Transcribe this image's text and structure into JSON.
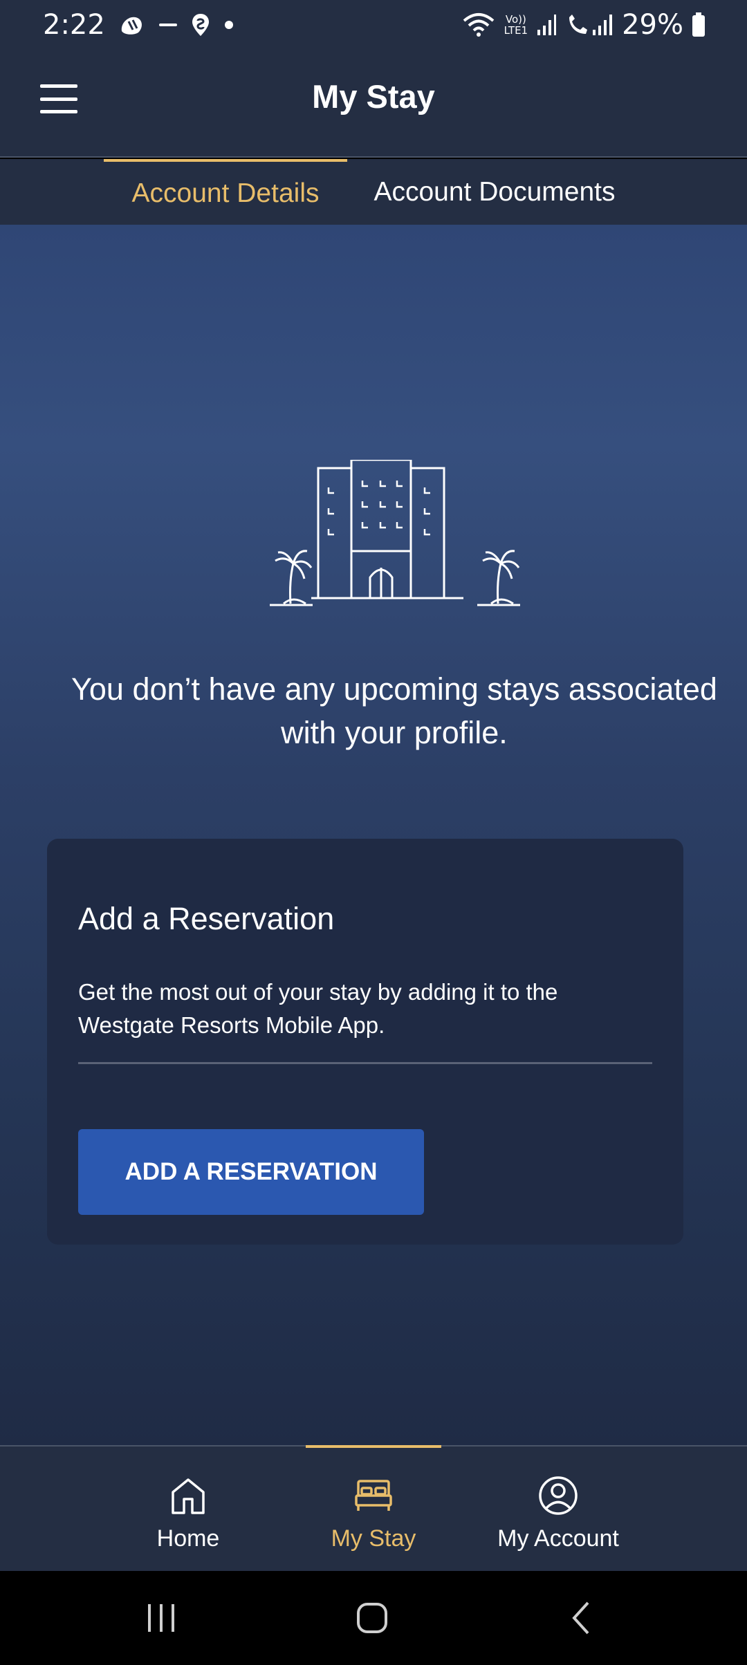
{
  "status_bar": {
    "time": "2:22",
    "battery": "29%",
    "icons_left": [
      "app-notification-icon",
      "rapido-icon",
      "swiggy-icon",
      "dot-icon"
    ],
    "icons_right": [
      "wifi-icon",
      "volte-icon",
      "signal-icon",
      "call-signal-icon",
      "battery-icon"
    ],
    "volte_label": "Vo))",
    "lte_label": "LTE1"
  },
  "header": {
    "title": "My Stay"
  },
  "tabs": [
    {
      "label": "Account Details",
      "active": true
    },
    {
      "label": "Account Documents",
      "active": false
    }
  ],
  "empty_state": {
    "message": "You don’t have any upcoming stays associated with your profile."
  },
  "reservation_card": {
    "title": "Add a Reservation",
    "description": "Get the most out of your stay by adding it to the Westgate Resorts Mobile App.",
    "button_label": "ADD A RESERVATION"
  },
  "bottom_nav": {
    "items": [
      {
        "label": "Home",
        "icon": "home-icon",
        "active": false
      },
      {
        "label": "My Stay",
        "icon": "bed-icon",
        "active": true
      },
      {
        "label": "My Account",
        "icon": "user-circle-icon",
        "active": false
      }
    ]
  },
  "colors": {
    "header_bg": "#242e43",
    "accent": "#e8bd6a",
    "button_bg": "#2b58b0",
    "card_bg": "#1f2a44"
  }
}
